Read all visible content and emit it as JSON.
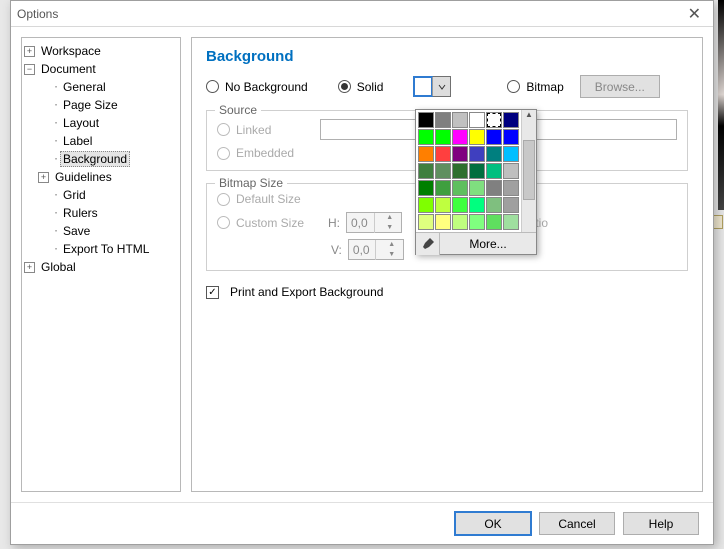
{
  "window": {
    "title": "Options"
  },
  "tree": {
    "workspace": "Workspace",
    "document": "Document",
    "general": "General",
    "pagesize": "Page Size",
    "layout": "Layout",
    "label": "Label",
    "background": "Background",
    "guidelines": "Guidelines",
    "grid": "Grid",
    "rulers": "Rulers",
    "save": "Save",
    "export": "Export To HTML",
    "global": "Global"
  },
  "heading": "Background",
  "radios": {
    "nobg": "No Background",
    "solid": "Solid",
    "bitmap": "Bitmap"
  },
  "browse": "Browse...",
  "source": {
    "legend": "Source",
    "linked": "Linked",
    "embedded": "Embedded"
  },
  "bitmap": {
    "legend": "Bitmap Size",
    "default": "Default Size",
    "custom": "Custom Size",
    "h": "H:",
    "v": "V:",
    "hval": "0,0",
    "vval": "0,0",
    "aspect": "Ratio"
  },
  "printexport": "Print and Export Background",
  "colorpicker": {
    "more": "More..."
  },
  "buttons": {
    "ok": "OK",
    "cancel": "Cancel",
    "help": "Help"
  },
  "palette": [
    "#000000",
    "#7f7f7f",
    "#c0c0c0",
    "#ffffff",
    "#ffffff",
    "#00007f",
    "#00ff00",
    "#00ff00",
    "#ff00ff",
    "#ffff00",
    "#0000ff",
    "#0000ff",
    "#ff7f00",
    "#ff3f3f",
    "#7f007f",
    "#3f3fbf",
    "#007f7f",
    "#00bfff",
    "#3f7f3f",
    "#5f8f5f",
    "#2f6f2f",
    "#006f3f",
    "#00bf7f",
    "#bfbfbf",
    "#007f00",
    "#3f9f3f",
    "#5fbf5f",
    "#7fdf7f",
    "#808080",
    "#a0a0a0",
    "#7fff00",
    "#bfff3f",
    "#3fff3f",
    "#00ff7f",
    "#7fbf7f",
    "#9f9f9f",
    "#dfff7f",
    "#ffff7f",
    "#bfff7f",
    "#7fff7f",
    "#5fdf5f",
    "#9fdf9f"
  ]
}
